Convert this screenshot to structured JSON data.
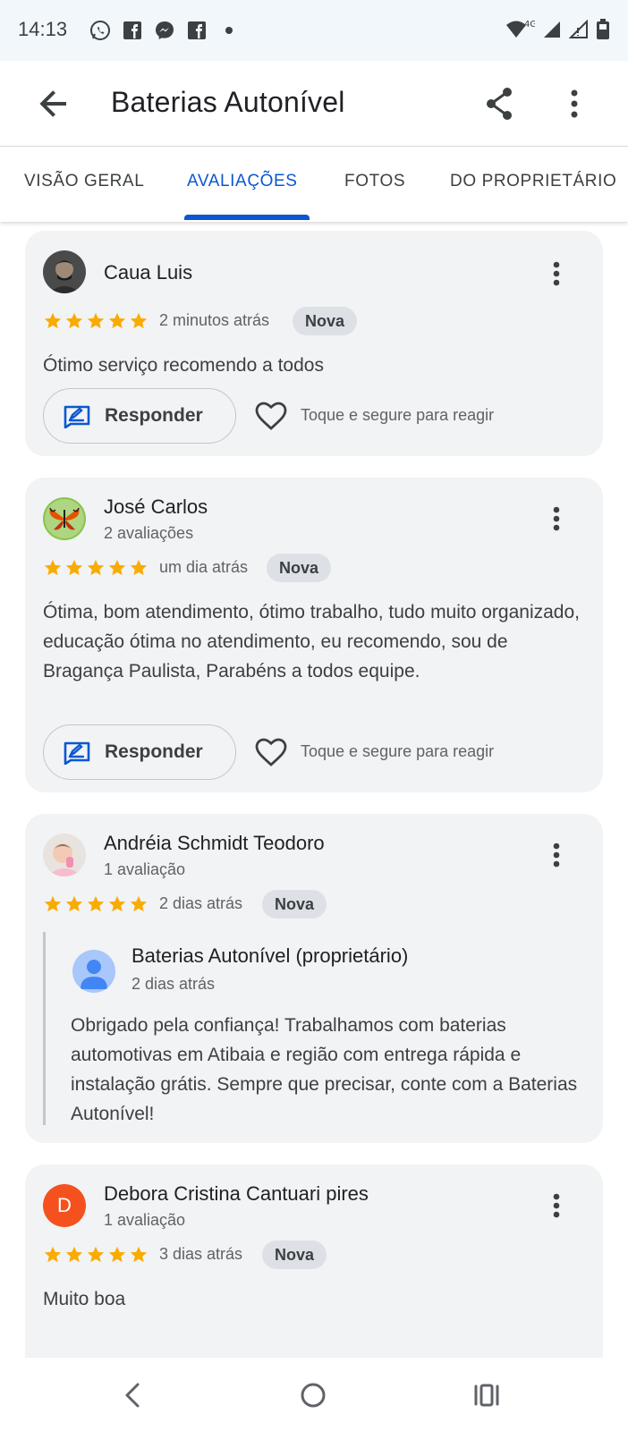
{
  "status_bar": {
    "time": "14:13",
    "left_icons": [
      "whatsapp-icon",
      "facebook-icon",
      "messenger-icon",
      "facebook-icon",
      "dot-icon"
    ],
    "network": "4G",
    "right_icons": [
      "wifi-icon",
      "signal-icon",
      "signal-icon",
      "battery-icon"
    ]
  },
  "app_bar": {
    "title": "Baterias Autonível",
    "back_icon": "arrow-back-icon",
    "share_icon": "share-icon",
    "more_icon": "more-vert-icon"
  },
  "tabs": [
    {
      "label": "VISÃO GERAL",
      "active": false
    },
    {
      "label": "AVALIAÇÕES",
      "active": true
    },
    {
      "label": "FOTOS",
      "active": false
    },
    {
      "label": "DO PROPRIETÁRIO",
      "active": false
    }
  ],
  "accent_color": "#0b57d0",
  "star_color": "#f9ab00",
  "reviews": [
    {
      "name": "Caua Luis",
      "subtitle": "",
      "rating": 5,
      "time": "2 minutos atrás",
      "badge": "Nova",
      "text": "Ótimo serviço recomendo a todos",
      "reply_label": "Responder",
      "react_hint": "Toque e segure para reagir"
    },
    {
      "name": "José Carlos",
      "subtitle": "2 avaliações",
      "rating": 5,
      "time": "um dia atrás",
      "badge": "Nova",
      "text": "Ótima, bom atendimento, ótimo trabalho, tudo muito organizado, educação ótima no atendimento, eu recomendo, sou de Bragança Paulista, Parabéns a todos equipe.",
      "reply_label": "Responder",
      "react_hint": "Toque e segure para reagir"
    },
    {
      "name": "Andréia Schmidt Teodoro",
      "subtitle": "1 avaliação",
      "rating": 5,
      "time": "2 dias atrás",
      "badge": "Nova",
      "owner_reply": {
        "name": "Baterias Autonível (proprietário)",
        "time": "2 dias atrás",
        "text": "Obrigado pela confiança! Trabalhamos com baterias automotivas em Atibaia e região com entrega rápida e instalação grátis. Sempre que precisar, conte com a Baterias Autonível!"
      }
    },
    {
      "name": "Debora Cristina Cantuari pires",
      "subtitle": "1 avaliação",
      "avatar_letter": "D",
      "avatar_color": "#f4511e",
      "rating": 5,
      "time": "3 dias atrás",
      "badge": "Nova",
      "text": "Muito boa"
    }
  ],
  "nav_bar": {
    "icons": [
      "nav-back-icon",
      "nav-home-icon",
      "nav-recents-icon"
    ]
  }
}
